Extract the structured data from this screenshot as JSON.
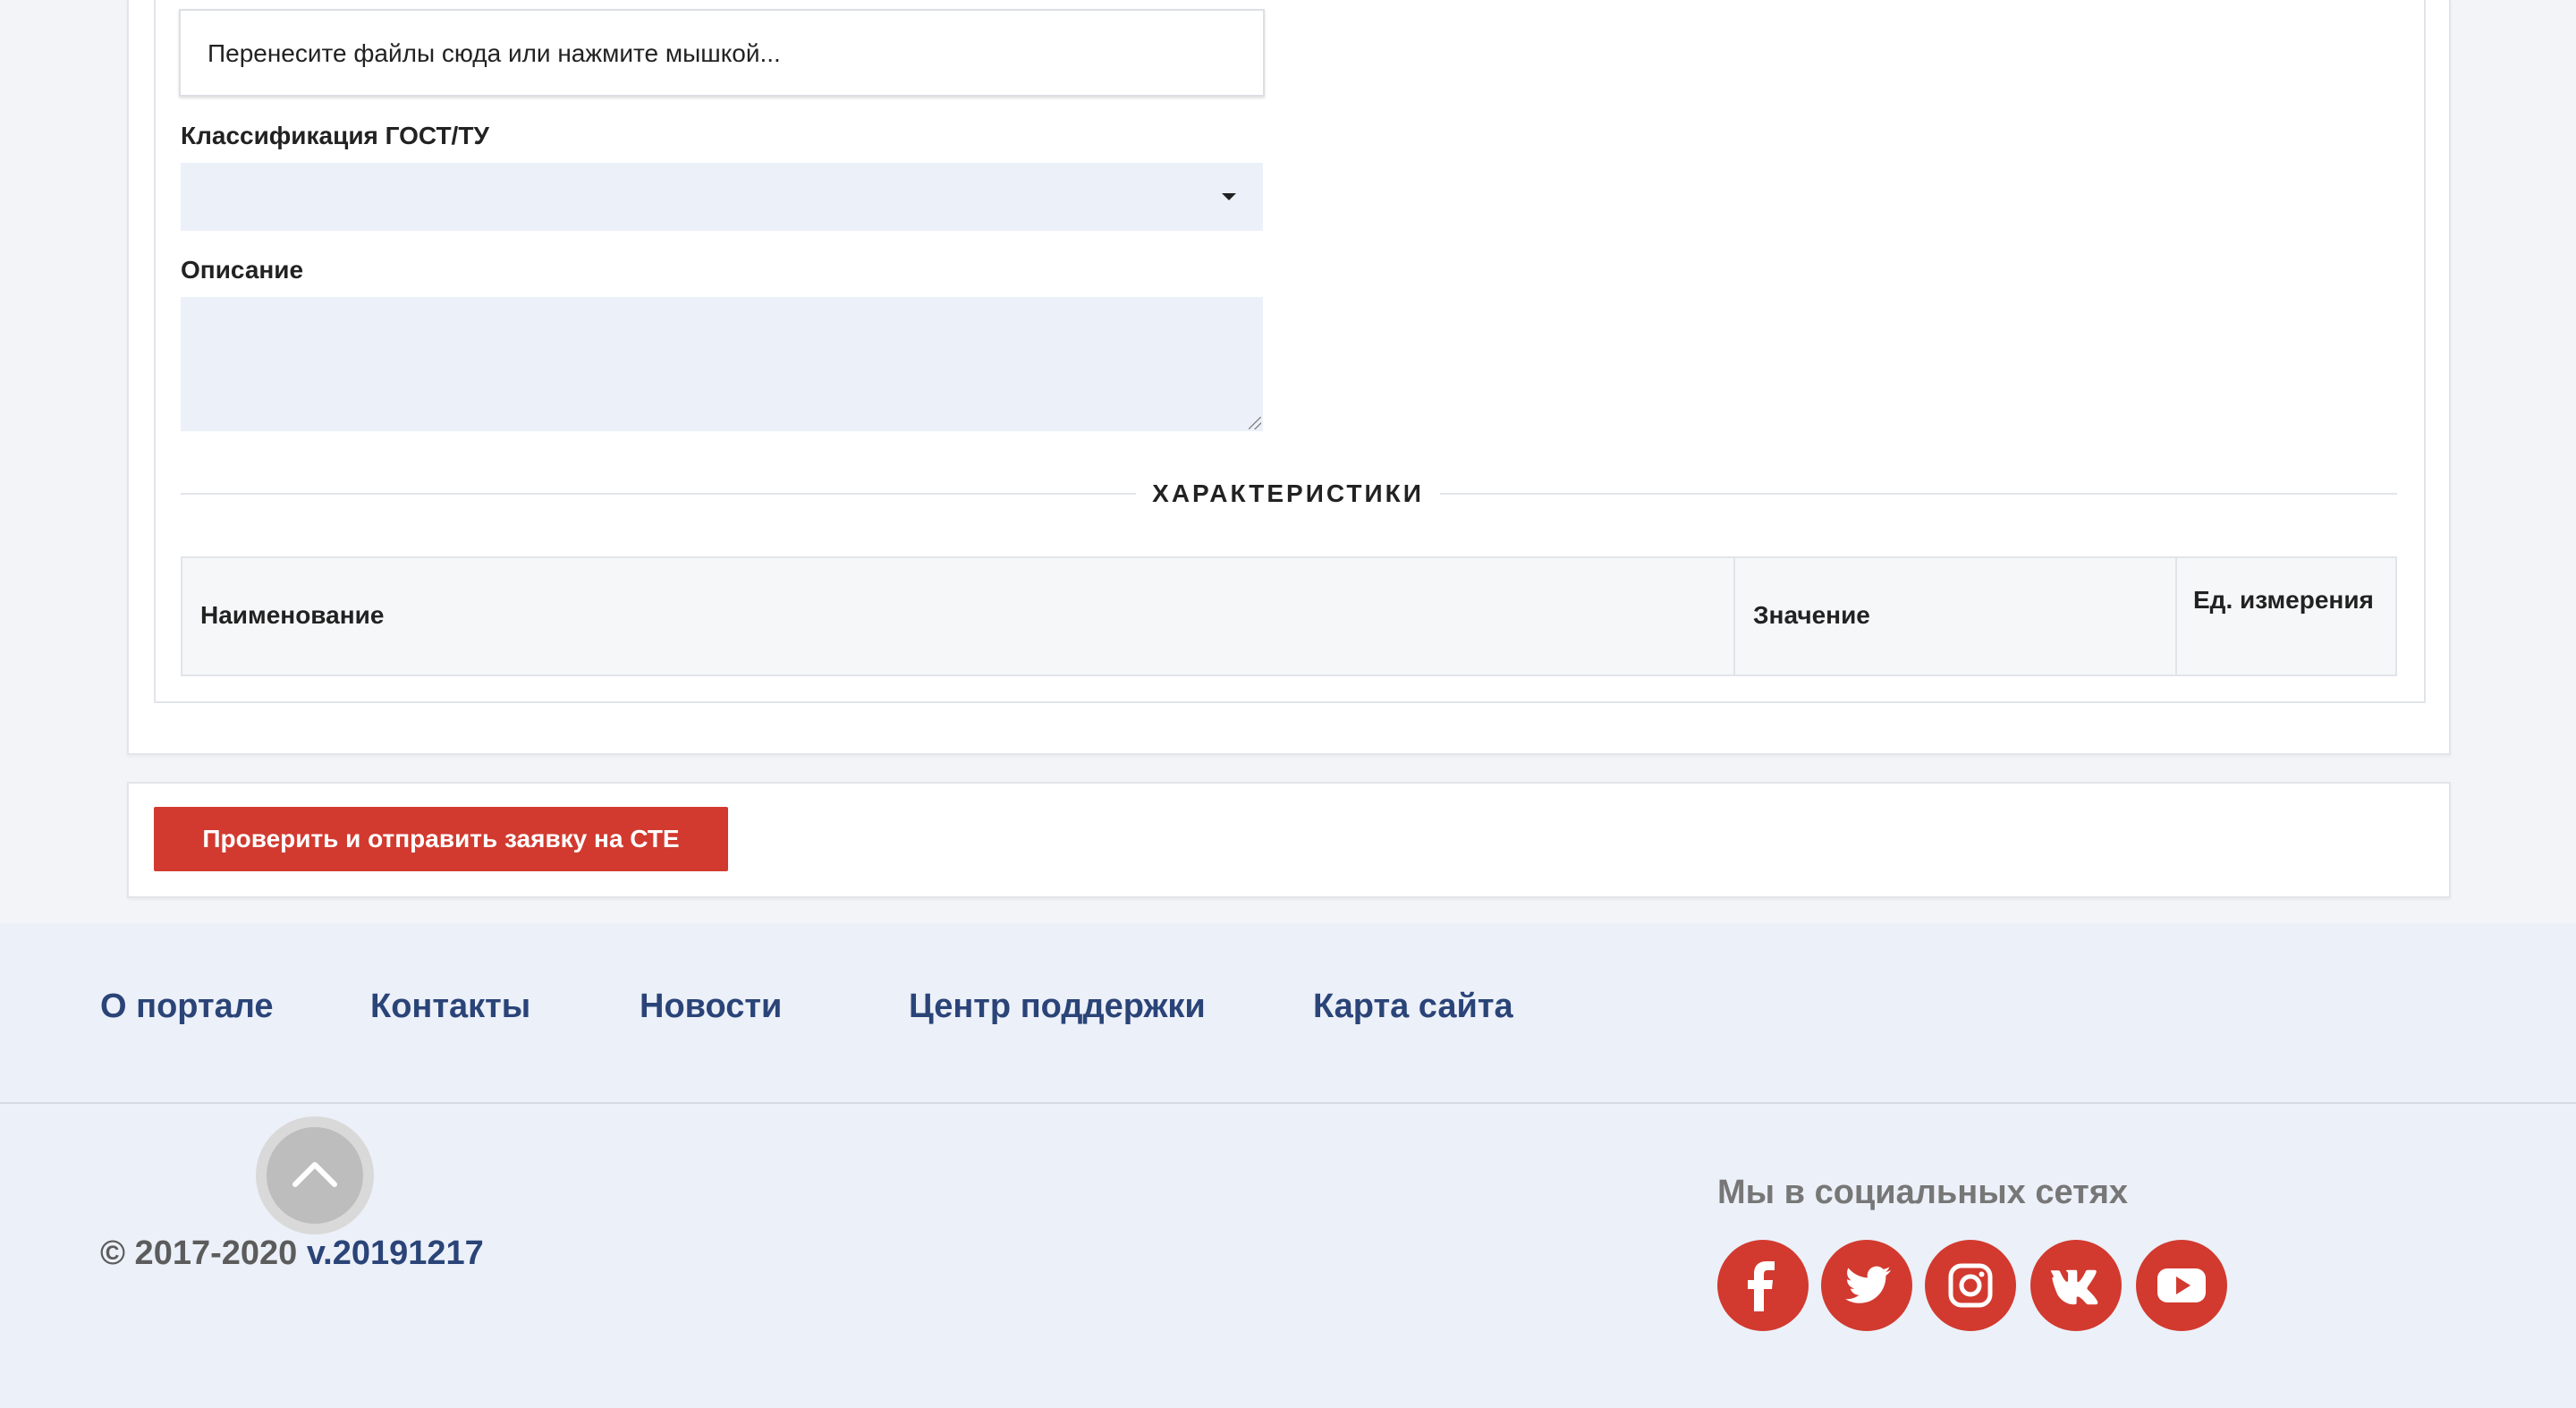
{
  "form": {
    "dropzone_text": "Перенесите файлы сюда или нажмите мышкой...",
    "gost_label": "Классификация ГОСТ/ТУ",
    "gost_value": "",
    "description_label": "Описание",
    "description_value": "",
    "characteristics_title": "ХАРАКТЕРИСТИКИ",
    "table_headers": [
      "Наименование",
      "Значение",
      "Ед. измерения"
    ],
    "submit_label": "Проверить и отправить заявку на СТЕ"
  },
  "footer": {
    "nav": [
      "О портале",
      "Контакты",
      "Новости",
      "Центр поддержки",
      "Карта сайта"
    ],
    "copyright": "© 2017-2020",
    "version": "v.20191217",
    "social_title": "Мы в социальных сетях",
    "social": [
      "facebook-icon",
      "twitter-icon",
      "instagram-icon",
      "vk-icon",
      "youtube-icon"
    ]
  },
  "colors": {
    "accent_red": "#d23a2f",
    "link_blue": "#2a4478",
    "field_bg": "#ecf0f8",
    "footer_bg": "#ecf0f8"
  }
}
